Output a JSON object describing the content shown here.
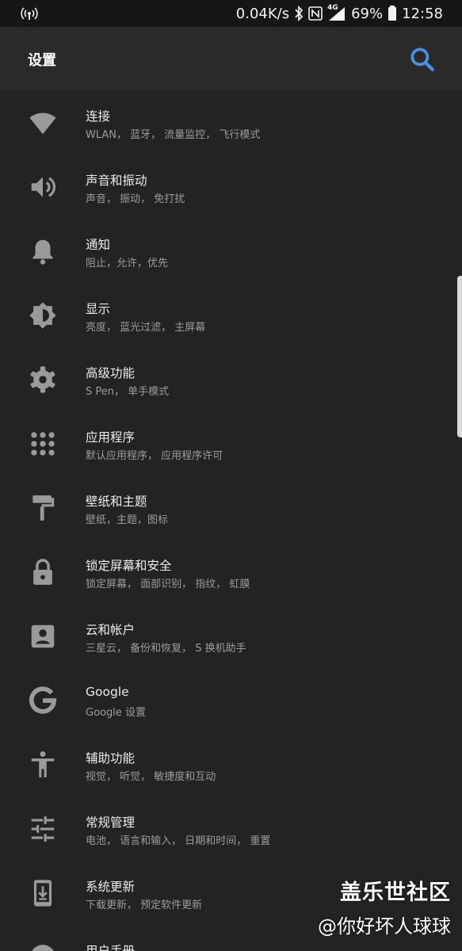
{
  "status_bar": {
    "speed": "0.04K/s",
    "network": "4G",
    "battery": "69%",
    "time": "12:58"
  },
  "appbar": {
    "title": "设置",
    "search_icon": "search-icon",
    "accent": "#4a90e2"
  },
  "settings": [
    {
      "title": "连接",
      "subtitle": "WLAN， 蓝牙， 流量监控， 飞行模式",
      "icon": "wifi-icon"
    },
    {
      "title": "声音和振动",
      "subtitle": "声音， 振动， 免打扰",
      "icon": "volume-icon"
    },
    {
      "title": "通知",
      "subtitle": "阻止，允许，优先",
      "icon": "bell-icon"
    },
    {
      "title": "显示",
      "subtitle": "亮度， 蓝光过滤， 主屏幕",
      "icon": "brightness-icon"
    },
    {
      "title": "高级功能",
      "subtitle": "S Pen， 单手模式",
      "icon": "gear-icon"
    },
    {
      "title": "应用程序",
      "subtitle": "默认应用程序， 应用程序许可",
      "icon": "apps-grid-icon"
    },
    {
      "title": "壁纸和主题",
      "subtitle": "壁纸，主题，图标",
      "icon": "paint-roller-icon"
    },
    {
      "title": "锁定屏幕和安全",
      "subtitle": "锁定屏幕， 面部识别， 指纹， 虹膜",
      "icon": "lock-icon"
    },
    {
      "title": "云和帐户",
      "subtitle": "三星云， 备份和恢复， S 换机助手",
      "icon": "account-box-icon"
    },
    {
      "title": "Google",
      "subtitle": "Google 设置",
      "icon": "google-icon"
    },
    {
      "title": "辅助功能",
      "subtitle": "视觉， 听觉， 敏捷度和互动",
      "icon": "accessibility-icon"
    },
    {
      "title": "常规管理",
      "subtitle": "电池， 语言和输入， 日期和时间， 重置",
      "icon": "sliders-icon"
    },
    {
      "title": "系统更新",
      "subtitle": "下载更新， 预定软件更新",
      "icon": "system-update-icon"
    },
    {
      "title": "用户手册",
      "subtitle": "",
      "icon": "help-icon"
    }
  ],
  "watermark": {
    "line1": "盖乐世社区",
    "line2": "@你好坏人球球"
  }
}
